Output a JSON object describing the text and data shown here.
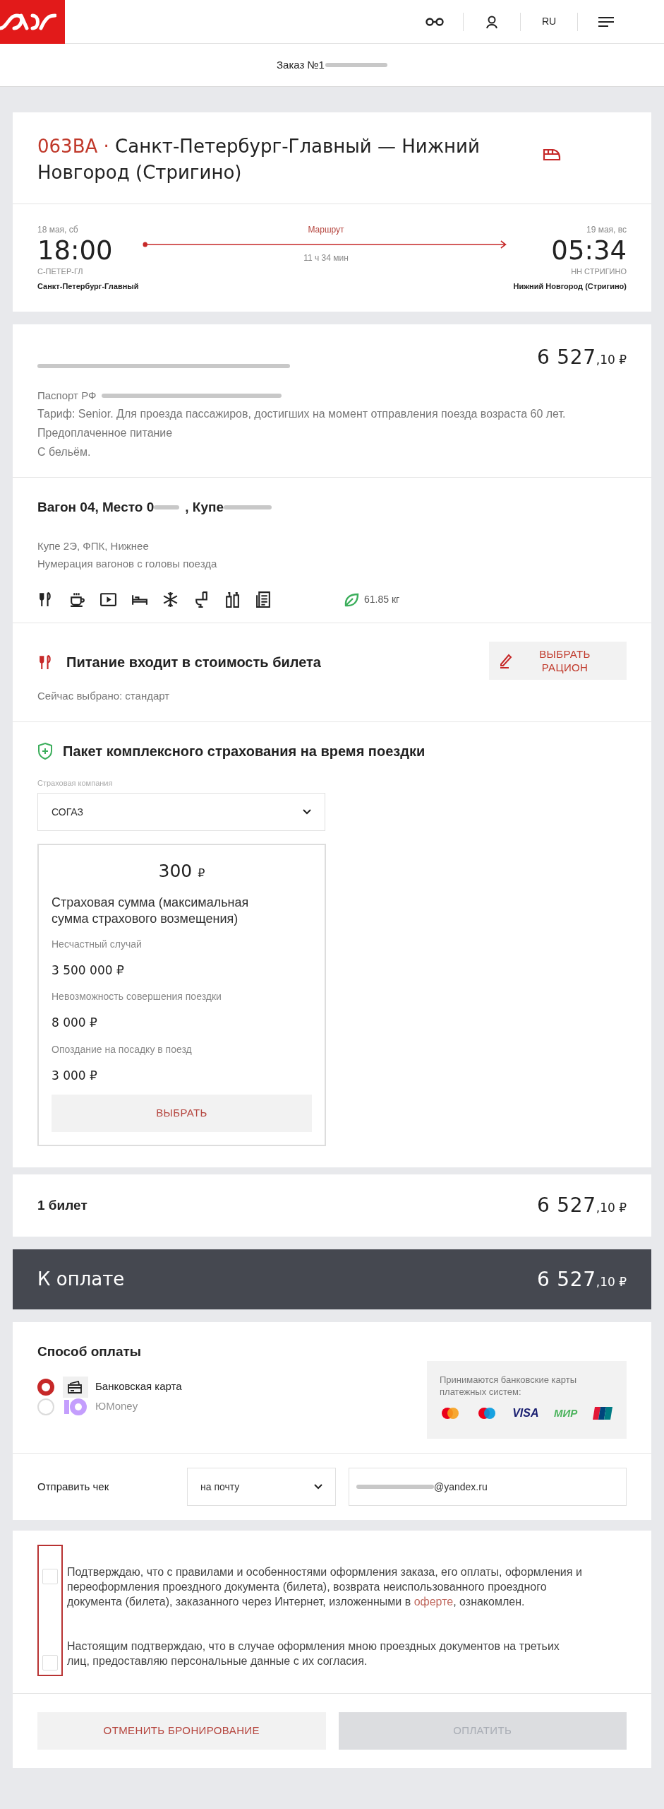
{
  "header": {
    "language": "RU"
  },
  "order": {
    "title": "Заказ №1"
  },
  "trip": {
    "train": "063ВА",
    "separator": "·",
    "route": "Санкт-Петербург-Главный — Нижний Новгород (Стригино)",
    "route_label": "Маршрут",
    "duration": "11 ч 34 мин",
    "departure": {
      "date": "18 мая, сб",
      "time": "18:00",
      "code": "С-ПЕТЕР-ГЛ",
      "station": "Санкт-Петербург-Главный"
    },
    "arrival": {
      "date": "19 мая, вс",
      "time": "05:34",
      "code": "НН СТРИГИНО",
      "station": "Нижний Новгород (Стригино)"
    }
  },
  "passenger": {
    "price": {
      "main": "6 527",
      "fraction": ",10",
      "currency": "₽"
    },
    "document": "Паспорт РФ",
    "details": [
      "Тариф: Senior. Для проезда пассажиров, достигших на момент отправления поезда возраста 60 лет.",
      "Предоплаченное питание",
      "С бельём."
    ]
  },
  "seat": {
    "wagon": "Вагон 04, Место 0",
    "compartment": ", Купе",
    "details": [
      "Купе 2Э, ФПК, Нижнее",
      "Нумерация вагонов с головы поезда"
    ],
    "amenities": [
      {
        "kind": "food"
      },
      {
        "kind": "coffee"
      },
      {
        "kind": "video"
      },
      {
        "kind": "bed"
      },
      {
        "kind": "ac"
      },
      {
        "kind": "toilet"
      },
      {
        "kind": "hygiene"
      },
      {
        "kind": "press"
      }
    ],
    "co2": "61.85 кг"
  },
  "meal": {
    "title": "Питание входит в стоимость билета",
    "button": "ВЫБРАТЬ РАЦИОН",
    "current": "Сейчас выбрано: стандарт"
  },
  "insurance": {
    "title": "Пакет комплексного страхования на время поездки",
    "company_label": "Страховая компания",
    "company": "СОГАЗ",
    "offer": {
      "price": "300",
      "currency": "₽",
      "sum_title": "Страховая сумма (максимальная сумма страхового возмещения)",
      "items": [
        {
          "label": "Несчастный случай",
          "amount": "3 500 000 ₽"
        },
        {
          "label": "Невозможность совершения поездки",
          "amount": "8 000 ₽"
        },
        {
          "label": "Опоздание на посадку в поезд",
          "amount": "3 000 ₽"
        }
      ],
      "button": "ВЫБРАТЬ"
    }
  },
  "summary": {
    "label": "1 билет",
    "price": {
      "main": "6 527",
      "fraction": ",10",
      "currency": "₽"
    }
  },
  "total": {
    "label": "К оплате",
    "price": {
      "main": "6 527",
      "fraction": ",10",
      "currency": "₽"
    }
  },
  "payment": {
    "title": "Способ оплаты",
    "methods": [
      {
        "kind": "card",
        "label": "Банковская карта",
        "selected": true,
        "disabled": false
      },
      {
        "kind": "yoomoney",
        "label": "ЮMoney",
        "selected": false,
        "disabled": true
      }
    ],
    "accepted": "Принимаются банковские карты платежных систем:",
    "systems": [
      {
        "kind": "mastercard"
      },
      {
        "kind": "maestro"
      },
      {
        "kind": "visa",
        "label": "VISA"
      },
      {
        "kind": "mir",
        "label": "МИР"
      },
      {
        "kind": "unionpay"
      }
    ]
  },
  "receipt": {
    "label": "Отправить чек",
    "method": "на почту",
    "email": "@yandex.ru"
  },
  "consents": {
    "highlighted": true,
    "items": [
      {
        "text": "Подтверждаю, что с правилами и особенностями оформления заказа, его оплаты, оформления и переоформления проездного документа (билета), возврата неиспользованного проездного документа (билета), заказанного через Интернет, изложенными в",
        "link": "оферте",
        "after": ", ознакомлен.",
        "checked": false
      },
      {
        "text": "Настоящим подтверждаю, что в случае оформления мною проездных документов на третьих лиц, предоставляю персональные данные с их согласия.",
        "checked": false
      }
    ]
  },
  "actions": [
    {
      "kind": "cancel",
      "label": "ОТМЕНИТЬ БРОНИРОВАНИЕ",
      "disabled": false
    },
    {
      "kind": "pay",
      "label": "ОПЛАТИТЬ",
      "disabled": true
    }
  ]
}
